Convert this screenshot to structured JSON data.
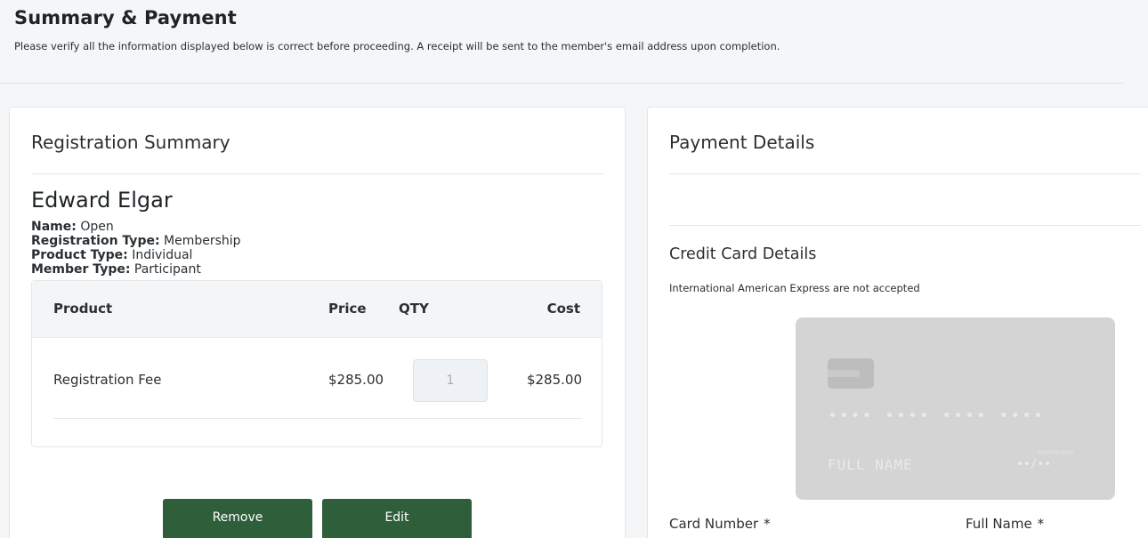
{
  "page": {
    "title": "Summary & Payment",
    "subtitle": "Please verify all the information displayed below is correct before proceeding.  A receipt will be sent to the member's email address upon completion."
  },
  "registration": {
    "heading": "Registration Summary",
    "member_name": "Edward Elgar",
    "details": [
      {
        "label": "Name:",
        "value": "Open"
      },
      {
        "label": "Registration Type:",
        "value": "Membership"
      },
      {
        "label": "Product Type:",
        "value": "Individual"
      },
      {
        "label": "Member Type:",
        "value": "Participant"
      }
    ],
    "table": {
      "headers": {
        "product": "Product",
        "price": "Price",
        "qty": "QTY",
        "cost": "Cost"
      },
      "rows": [
        {
          "product": "Registration Fee",
          "price": "$285.00",
          "qty": "1",
          "cost": "$285.00"
        }
      ]
    },
    "buttons": {
      "remove": "Remove",
      "edit": "Edit"
    }
  },
  "payment": {
    "heading": "Payment Details",
    "cc_title": "Credit Card Details",
    "cc_note": "International American Express are not accepted",
    "card": {
      "number_mask": "•••• •••• •••• ••••",
      "name_placeholder": "FULL NAME",
      "expiry_label": "MONTH/YEAR",
      "expiry_mask": "••/••"
    },
    "fields": {
      "card_number_label": "Card Number",
      "full_name_label": "Full Name",
      "required_marker": "*"
    }
  },
  "colors": {
    "button_bg": "#2f5f3a",
    "card_bg": "#d4d4d4",
    "page_bg": "#f4f6f8"
  }
}
